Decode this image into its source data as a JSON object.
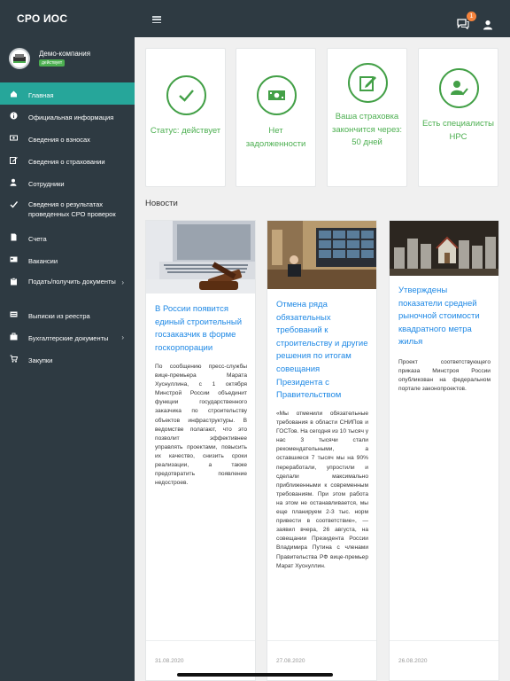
{
  "header": {
    "title": "СРО ИОС",
    "chat_badge": "1"
  },
  "company": {
    "name": "Демо-компания",
    "status": "действует"
  },
  "nav": [
    {
      "label": "Главная",
      "icon": "home-icon",
      "active": true
    },
    {
      "label": "Официальная информация",
      "icon": "info-icon"
    },
    {
      "label": "Сведения о взносах",
      "icon": "money-icon"
    },
    {
      "label": "Сведения о страховании",
      "icon": "edit-icon"
    },
    {
      "label": "Сотрудники",
      "icon": "user-icon"
    },
    {
      "label": "Сведения о результатах проведенных СРО проверок",
      "icon": "check-icon"
    },
    {
      "label": "Счета",
      "icon": "document-icon"
    },
    {
      "label": "Вакансии",
      "icon": "id-card-icon"
    },
    {
      "label": "Подать/получить документы",
      "icon": "clipboard-icon",
      "has_submenu": true
    },
    {
      "label": "Выписки из реестра",
      "icon": "list-icon"
    },
    {
      "label": "Бухгалтерские документы",
      "icon": "briefcase-icon",
      "has_submenu": true
    },
    {
      "label": "Закупки",
      "icon": "cart-icon"
    }
  ],
  "stats": [
    {
      "icon": "checkmark-icon",
      "text": "Статус: действует"
    },
    {
      "icon": "banknote-icon",
      "text": "Нет задолженности"
    },
    {
      "icon": "edit-document-icon",
      "text": "Ваша страховка закончится через: 50 дней"
    },
    {
      "icon": "user-check-icon",
      "text": "Есть специалисты НРС"
    }
  ],
  "news_title": "Новости",
  "news": [
    {
      "image": "gavel-laptop-image",
      "title": "В России появится единый строительный госзаказчик в форме госкорпорации",
      "body": "По сообщению пресс-службы вице-премьера Марата Хуснуллина, с 1 октября Минстрой России объединит функции государственного заказчика по строительству объектов инфраструктуры. В ведомстве полагают, что это позволит эффективнее управлять проектами, повысить их качество, снизить сроки реализации, а также предотвратить появление недостроев.",
      "date": "31.08.2020"
    },
    {
      "image": "videoconference-meeting-image",
      "title": "Отмена ряда обязательных требований к строительству и другие решения по итогам совещания Президента с Правительством",
      "body": "«Мы отменили обязательные требования в области СНИПов и ГОСТов. На сегодня из 10 тысяч у нас 3 тысячи стали рекомендательными, а оставшиеся 7 тысяч мы на 90% переработали, упростили и сделали максимально приближенными к современным требованиям. При этом работа на этом не останавливается, мы еще планируем 2-3 тыс. норм привести в соответствие», — заявил вчера, 26 августа, на совещании Президента России Владимира Путина с членами Правительства РФ вице-премьер Марат Хуснуллин.",
      "date": "27.08.2020"
    },
    {
      "image": "coins-houses-image",
      "title": "Утверждены показатели средней рыночной стоимости квадратного метра жилья",
      "body": "Проект соответствующего приказа Минстроя России опубликован на федеральном портале законопроектов.",
      "date": "26.08.2020"
    }
  ]
}
